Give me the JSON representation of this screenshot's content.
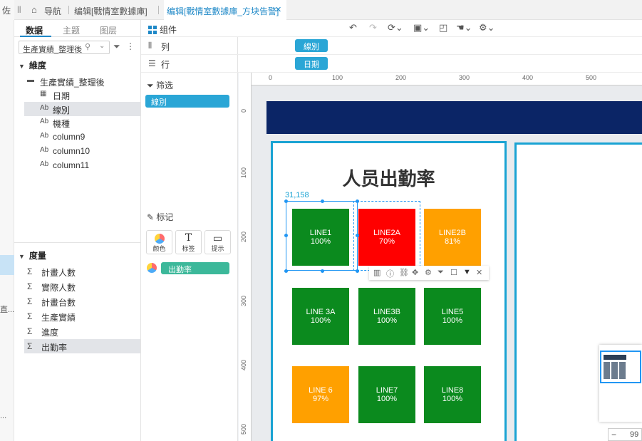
{
  "tabs": {
    "nav_label": "导航",
    "tab1_label": "编辑[戰情室數據庫]",
    "active_tab_label": "编辑[戰情室數據庫_方块告警]"
  },
  "left_strip": {
    "top_char": "佐",
    "mid_text": "直...",
    "bottom_text": "..."
  },
  "left_panel": {
    "tabs": [
      "数据",
      "主题",
      "图层"
    ],
    "search_value": "生產實績_整理後",
    "dimension_header": "維度",
    "dimension_folder": "生產實績_整理後",
    "dimensions": [
      {
        "type": "date",
        "label": "日期"
      },
      {
        "type": "text",
        "label": "線別"
      },
      {
        "type": "text",
        "label": "機種"
      },
      {
        "type": "text",
        "label": "column9"
      },
      {
        "type": "text",
        "label": "column10"
      },
      {
        "type": "text",
        "label": "column11"
      }
    ],
    "measure_header": "度量",
    "measures": [
      "計畫人數",
      "實際人數",
      "計畫台數",
      "生產實績",
      "進度",
      "出勤率"
    ]
  },
  "field_panel": {
    "component_label": "组件",
    "column_label": "列",
    "row_label": "行",
    "filter_label": "筛选",
    "filter_pill": "線別",
    "mark_label": "标记",
    "mark_buttons": [
      "颜色",
      "标签",
      "提示"
    ],
    "mark_pill": "出勤率"
  },
  "pills": {
    "column_value": "線別",
    "row_value": "日期"
  },
  "canvas": {
    "ruler_top": [
      "0",
      "100",
      "200",
      "300",
      "400",
      "500"
    ],
    "ruler_left": [
      "0",
      "100",
      "200",
      "300",
      "400",
      "500"
    ],
    "coord_label": "31,158",
    "zoom_value": "99",
    "zoom_minus": "−"
  },
  "chart_data": {
    "type": "heatmap",
    "title": "人员出勤率",
    "tiles": [
      {
        "line": "LINE1",
        "rate": "100%",
        "color": "#0b8a1e"
      },
      {
        "line": "LINE2A",
        "rate": "70%",
        "color": "#ff0000"
      },
      {
        "line": "LINE2B",
        "rate": "81%",
        "color": "#ffa000"
      },
      {
        "line": "LINE 3A",
        "rate": "100%",
        "color": "#0b8a1e"
      },
      {
        "line": "LINE3B",
        "rate": "100%",
        "color": "#0b8a1e"
      },
      {
        "line": "LINE5",
        "rate": "100%",
        "color": "#0b8a1e"
      },
      {
        "line": "LINE 6",
        "rate": "97%",
        "color": "#ffa000"
      },
      {
        "line": "LINE7",
        "rate": "100%",
        "color": "#0b8a1e"
      },
      {
        "line": "LINE8",
        "rate": "100%",
        "color": "#0b8a1e"
      }
    ]
  }
}
